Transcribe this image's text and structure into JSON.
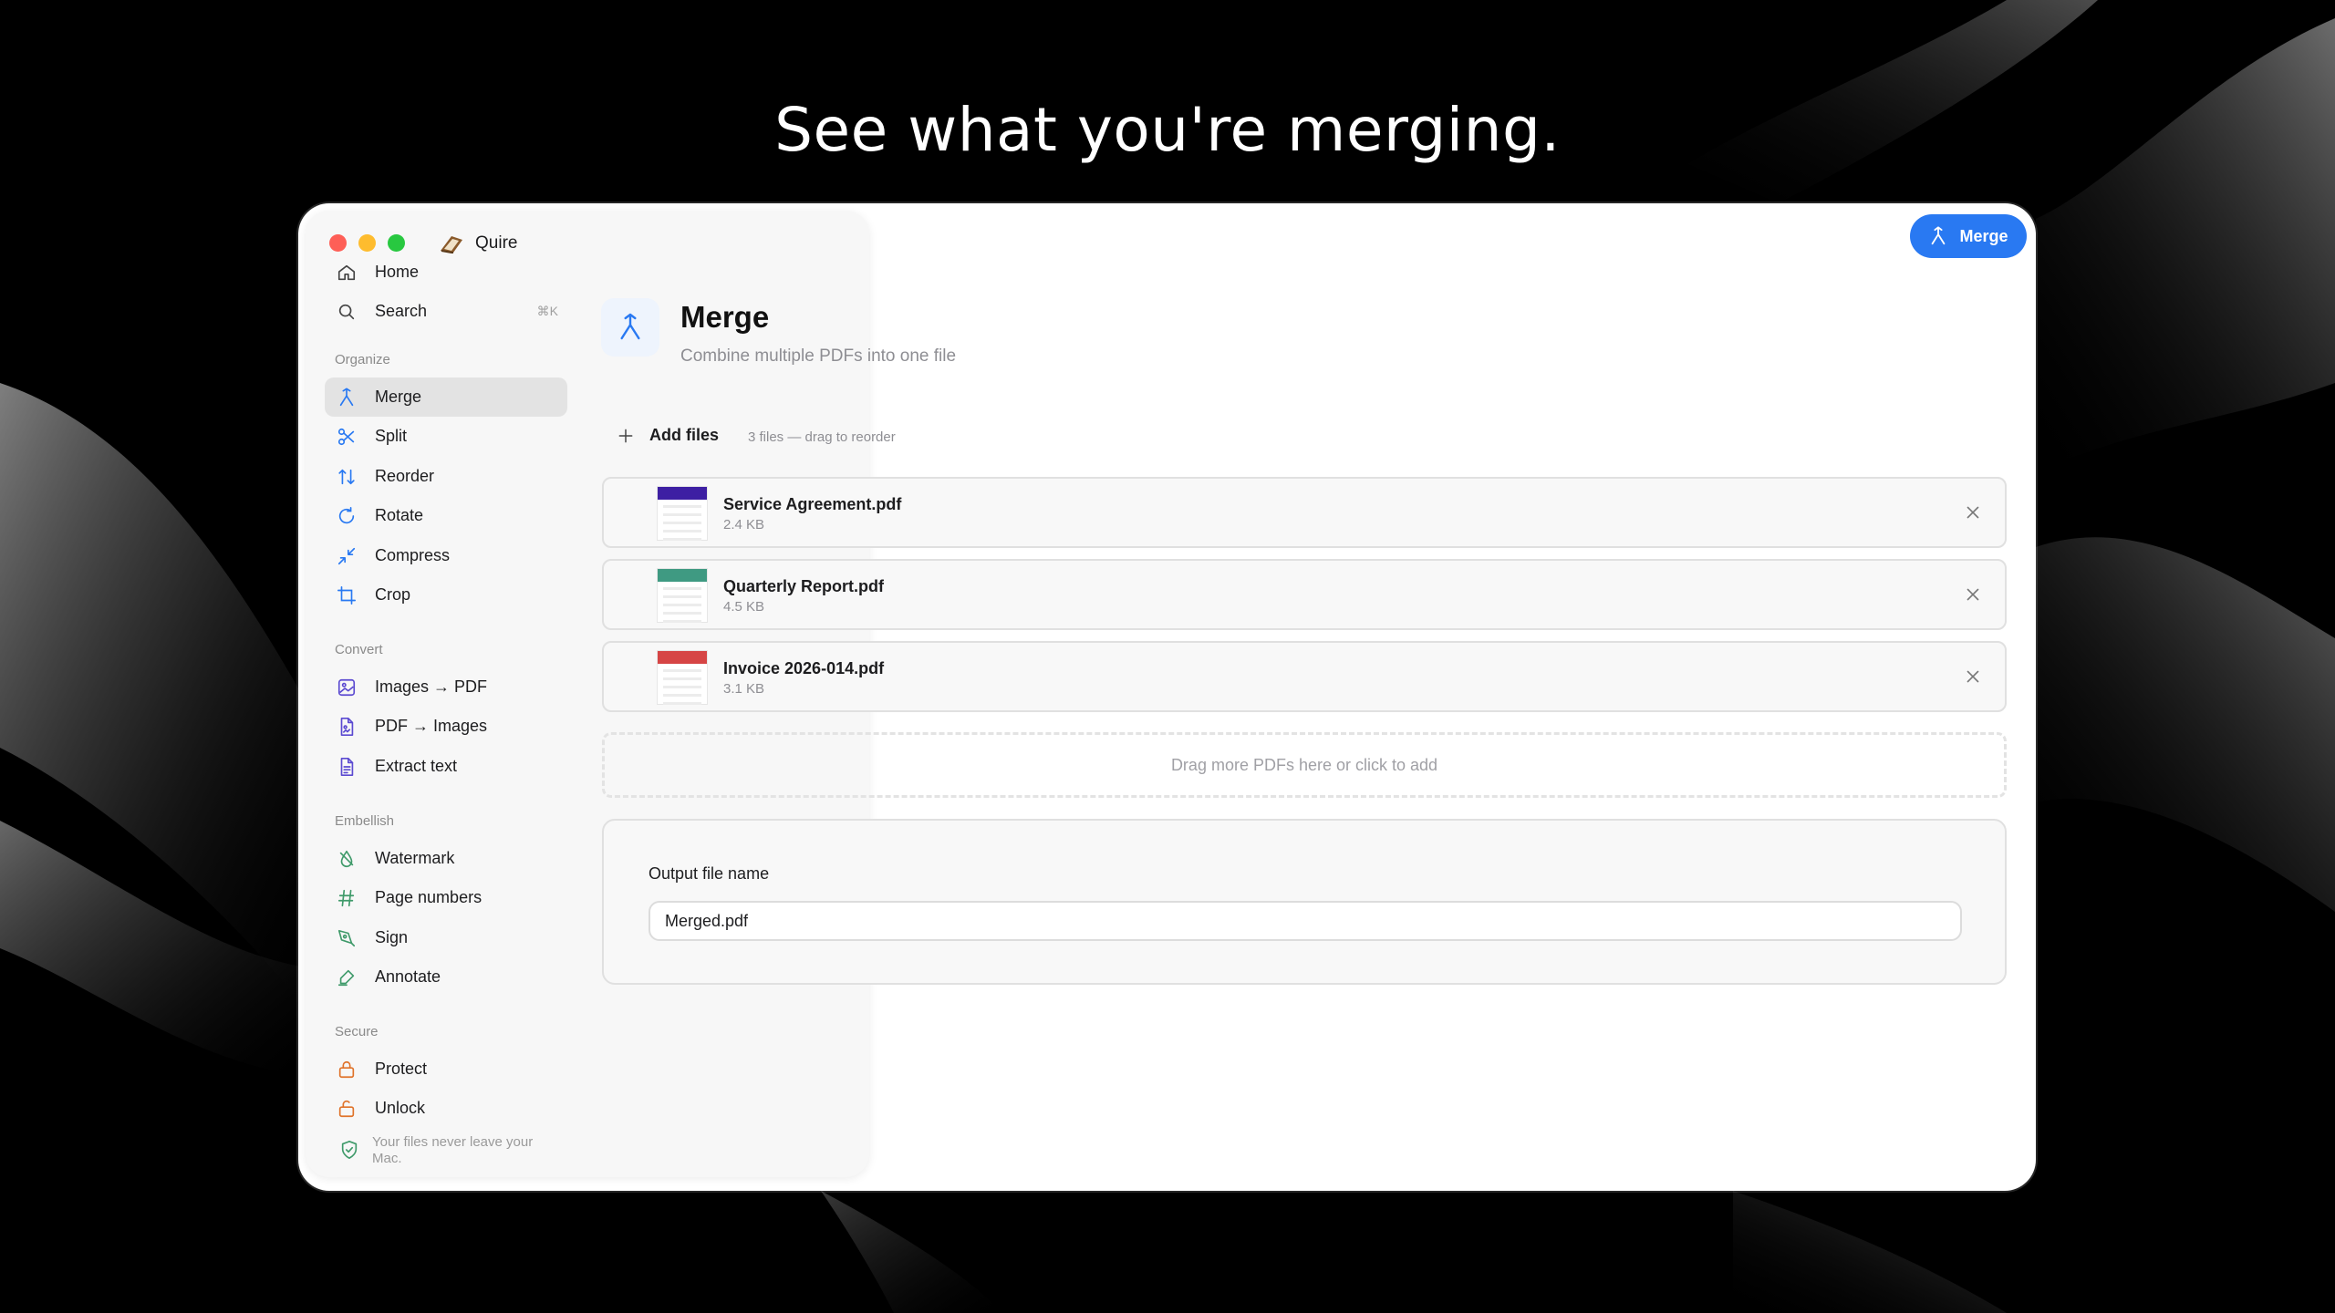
{
  "headline": "See what you're merging.",
  "app": {
    "name": "Quire",
    "primary_button": "Merge",
    "accent_color": "#2979f2"
  },
  "sidebar": {
    "top_items": [
      {
        "label": "Home",
        "icon": "home-icon"
      },
      {
        "label": "Search",
        "icon": "search-icon",
        "shortcut": "⌘K"
      }
    ],
    "sections": {
      "organize": "Organize",
      "convert": "Convert",
      "embellish": "Embellish",
      "secure": "Secure"
    },
    "organize_items": [
      {
        "label": "Merge",
        "icon": "merge-icon",
        "active": true
      },
      {
        "label": "Split",
        "icon": "scissors-icon"
      },
      {
        "label": "Reorder",
        "icon": "arrows-up-down-icon"
      },
      {
        "label": "Rotate",
        "icon": "rotate-icon"
      },
      {
        "label": "Compress",
        "icon": "compress-icon"
      },
      {
        "label": "Crop",
        "icon": "crop-icon"
      }
    ],
    "convert_items": [
      {
        "label": "Images → PDF",
        "icon": "image-to-pdf-icon"
      },
      {
        "label": "PDF → Images",
        "icon": "pdf-to-image-icon"
      },
      {
        "label": "Extract text",
        "icon": "document-text-icon"
      }
    ],
    "embellish_items": [
      {
        "label": "Watermark",
        "icon": "drop-icon"
      },
      {
        "label": "Page numbers",
        "icon": "hash-icon"
      },
      {
        "label": "Sign",
        "icon": "pen-nib-icon"
      },
      {
        "label": "Annotate",
        "icon": "highlighter-icon"
      }
    ],
    "secure_items": [
      {
        "label": "Protect",
        "icon": "lock-icon"
      },
      {
        "label": "Unlock",
        "icon": "unlock-icon"
      }
    ],
    "privacy_note": "Your files never leave your Mac."
  },
  "main": {
    "title": "Merge",
    "subtitle": "Combine multiple PDFs into one file",
    "add_files_label": "Add files",
    "files_hint": "3 files — drag to reorder",
    "files": [
      {
        "name": "Service Agreement.pdf",
        "size": "2.4 KB",
        "color": "#3d1fa3"
      },
      {
        "name": "Quarterly Report.pdf",
        "size": "4.5 KB",
        "color": "#3f9a82"
      },
      {
        "name": "Invoice 2026-014.pdf",
        "size": "3.1 KB",
        "color": "#d64545"
      }
    ],
    "dropzone_text": "Drag more PDFs here or click to add",
    "output": {
      "label": "Output file name",
      "value": "Merged.pdf"
    }
  }
}
